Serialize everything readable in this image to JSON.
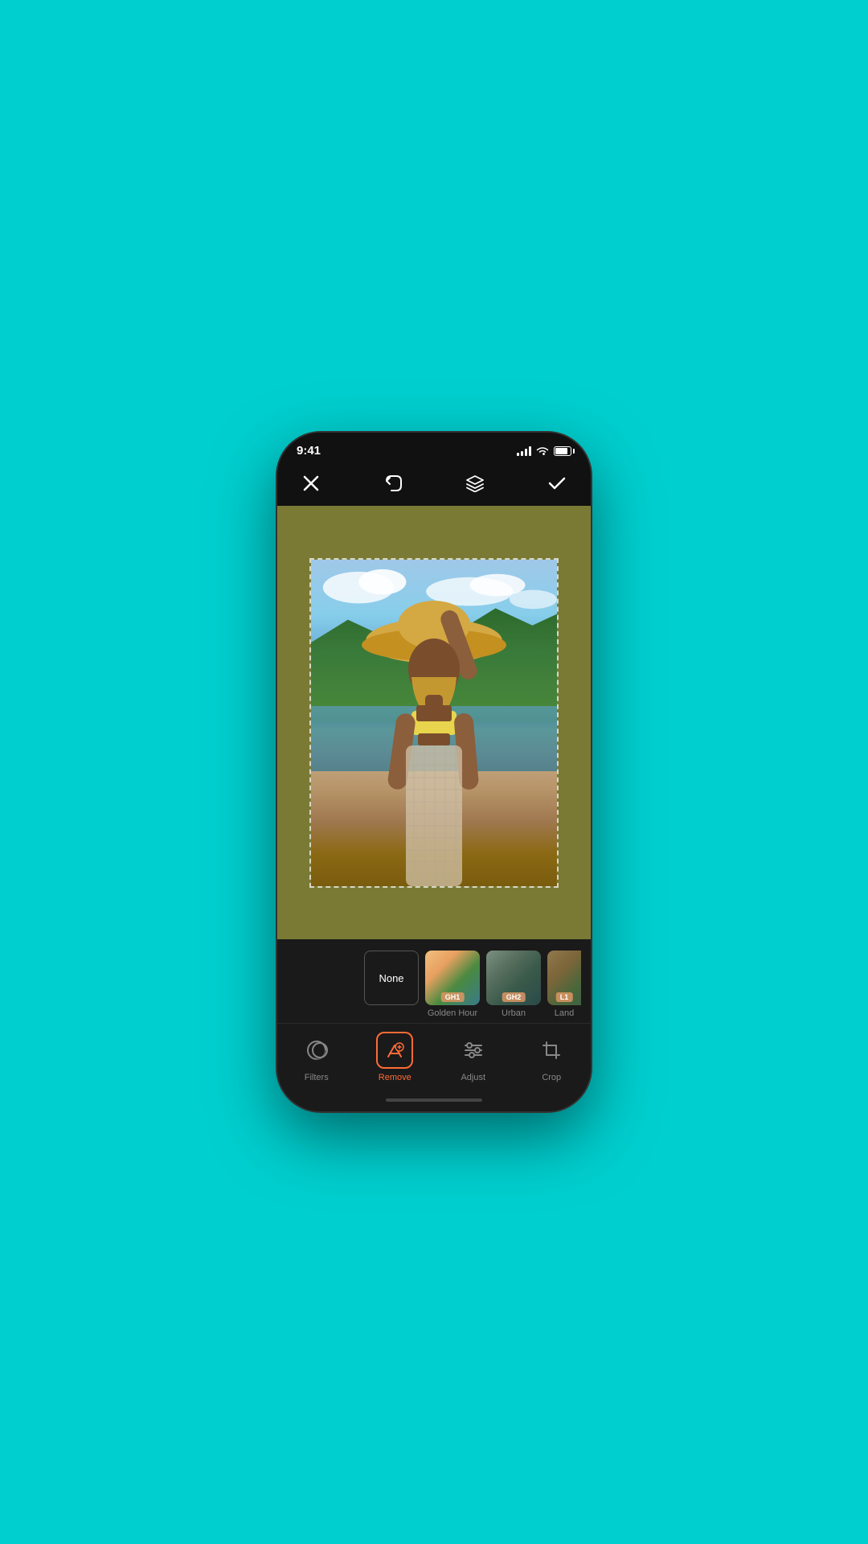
{
  "status": {
    "time": "9:41",
    "battery_pct": 85
  },
  "toolbar": {
    "close_label": "×",
    "undo_label": "↩",
    "layers_label": "layers",
    "confirm_label": "✓"
  },
  "filters": {
    "none_label": "None",
    "items": [
      {
        "id": "none",
        "label": "",
        "badge": ""
      },
      {
        "id": "gh1",
        "label": "Golden Hour",
        "badge": "GH1"
      },
      {
        "id": "gh2",
        "label": "Urban",
        "badge": "GH2"
      },
      {
        "id": "land",
        "label": "Land",
        "badge": "L1"
      }
    ]
  },
  "tools": [
    {
      "id": "filters",
      "label": "Filters",
      "active": false
    },
    {
      "id": "remove",
      "label": "Remove",
      "active": true
    },
    {
      "id": "adjust",
      "label": "Adjust",
      "active": false
    },
    {
      "id": "crop",
      "label": "Crop",
      "active": false
    }
  ]
}
